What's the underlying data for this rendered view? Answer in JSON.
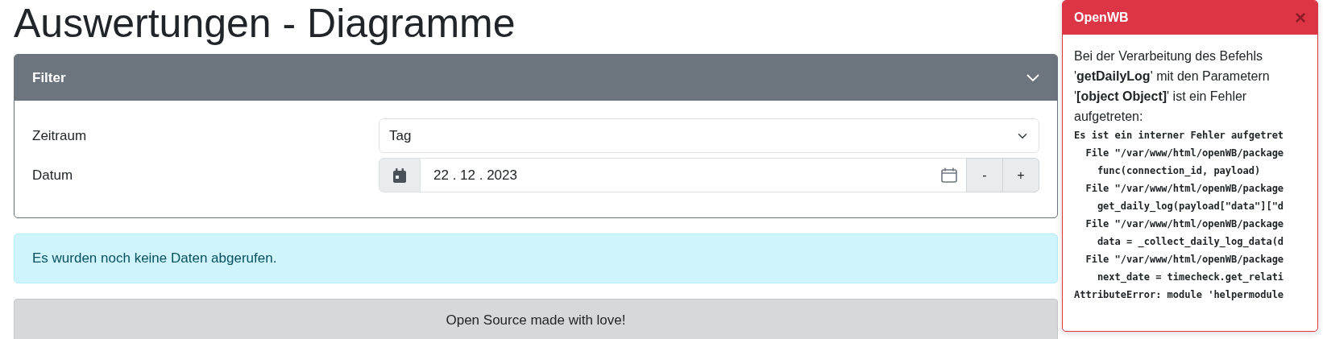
{
  "page": {
    "title": "Auswertungen - Diagramme"
  },
  "filter": {
    "title": "Filter",
    "expanded": true,
    "fields": [
      {
        "kind": "select",
        "label": "Zeitraum",
        "value": "Tag"
      },
      {
        "kind": "date",
        "label": "Datum",
        "value": "22 . 12 . 2023",
        "buttons": [
          "-",
          "+"
        ]
      }
    ]
  },
  "alert": {
    "text": "Es wurden noch keine Daten abgerufen."
  },
  "footer": {
    "text": "Open Source made with love!"
  },
  "toast": {
    "title": "OpenWB",
    "close": "×",
    "message": "Bei der Verarbeitung des Befehls '**getDailyLog**' mit den Parametern '**[object Object]**' ist ein Fehler aufgetreten:",
    "traceback": "Es ist ein interner Fehler aufgetret\n  File \"/var/www/html/openWB/package\n    func(connection_id, payload)\n  File \"/var/www/html/openWB/package\n    get_daily_log(payload[\"data\"][\"d\n  File \"/var/www/html/openWB/package\n    data = _collect_daily_log_data(d\n  File \"/var/www/html/openWB/package\n    next_date = timecheck.get_relati\nAttributeError: module 'helpermodule"
  }
}
